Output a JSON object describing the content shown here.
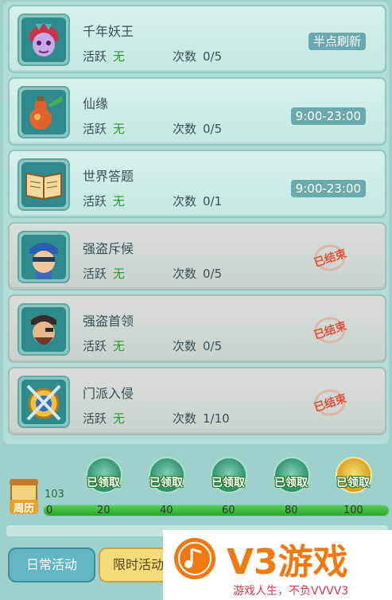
{
  "activities": [
    {
      "title": "千年妖王",
      "active_label": "活跃",
      "active_value": "无",
      "count_label": "次数",
      "count_value": "0/5",
      "time": "半点刷新",
      "ended": false,
      "icon": "demon-king-icon"
    },
    {
      "title": "仙缘",
      "active_label": "活跃",
      "active_value": "无",
      "count_label": "次数",
      "count_value": "0/5",
      "time": "9:00-23:00",
      "ended": false,
      "icon": "gourd-icon"
    },
    {
      "title": "世界答题",
      "active_label": "活跃",
      "active_value": "无",
      "count_label": "次数",
      "count_value": "0/1",
      "time": "9:00-23:00",
      "ended": false,
      "icon": "book-icon"
    },
    {
      "title": "强盗斥候",
      "active_label": "活跃",
      "active_value": "无",
      "count_label": "次数",
      "count_value": "0/5",
      "stamp": "已结束",
      "ended": true,
      "icon": "bandit-scout-icon"
    },
    {
      "title": "强盗首领",
      "active_label": "活跃",
      "active_value": "无",
      "count_label": "次数",
      "count_value": "0/5",
      "stamp": "已结束",
      "ended": true,
      "icon": "bandit-leader-icon"
    },
    {
      "title": "门派入侵",
      "active_label": "活跃",
      "active_value": "无",
      "count_label": "次数",
      "count_value": "1/10",
      "stamp": "已结束",
      "ended": true,
      "icon": "sect-invasion-icon"
    }
  ],
  "rewards": {
    "calendar_label": "周历",
    "progress_value": "103",
    "progress_fraction": 1.0,
    "ticks": [
      "0",
      "20",
      "40",
      "60",
      "80",
      "100"
    ],
    "chests": [
      "已领取",
      "已领取",
      "已领取",
      "已领取",
      "已领取"
    ]
  },
  "tabs": {
    "daily": "日常活动",
    "limited": "限时活动"
  },
  "watermark": {
    "title": "V3游戏",
    "subtitle": "游戏人生，不负VVVV3"
  },
  "colors": {
    "active_green": "#2b9b2b",
    "badge": "#6aa9ad",
    "stamp_red": "#e0533a",
    "watermark_orange": "#f07a12"
  }
}
